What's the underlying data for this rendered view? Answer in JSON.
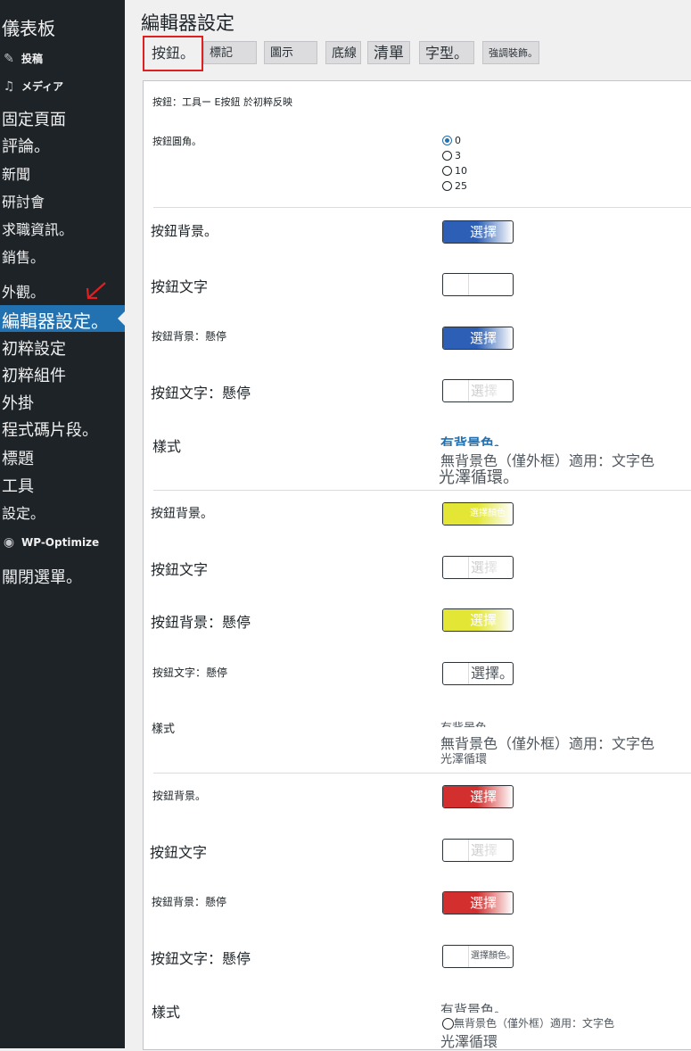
{
  "sidebar": {
    "dashboard": "儀表板",
    "posts": "投稿",
    "media": "メディア",
    "pages": "固定頁面",
    "comments": "評論。",
    "news": "新聞",
    "seminar": "研討會",
    "jobs": "求職資訊。",
    "sales": "銷售。",
    "appearance": "外觀。",
    "editor_settings": "編輯器設定。",
    "initial_settings": "初粹設定",
    "initial_blocks": "初粹組件",
    "plugins": "外掛",
    "code_snippets": "程式碼片段。",
    "titles": "標題",
    "tools": "工具",
    "settings": "設定。",
    "wp_optimize": "WP-Optimize",
    "close_menu": "關閉選單。"
  },
  "page": {
    "title": "編輯器設定"
  },
  "tabs": [
    "按鈕。",
    "標記",
    "圖示",
    "底線",
    "清單",
    "字型。",
    "強調裝飾。"
  ],
  "panel": {
    "description": "按鈕：工具ー E按鈕 於初粹反映",
    "radius_label": "按鈕圓角。",
    "radius_options": [
      "0",
      "3",
      "10",
      "25"
    ],
    "radius_selected": "0"
  },
  "groups": [
    {
      "bg": "按鈕背景。",
      "text": "按鈕文字",
      "bg_hover": "按鈕背景：懸停",
      "text_hover": "按鈕文字：懸停",
      "style": "樣式",
      "bg_color": "#2c5fb5",
      "text_color": "#ffffff",
      "bg_hover_color": "#2c5fb5",
      "text_hover_color": "#ffffff",
      "bg_pick": "選擇",
      "text_pick": "",
      "bg_hover_pick": "選擇",
      "text_hover_pick": "選擇",
      "style_opt1": "有背景色。",
      "style_opt2": "無背景色（僅外框）適用：文字色",
      "style_opt3": "光澤循環。"
    },
    {
      "bg": "按鈕背景。",
      "text": "按鈕文字",
      "bg_hover": "按鈕背景：懸停",
      "text_hover": "按鈕文字：懸停",
      "style": "樣式",
      "bg_color": "#e3e635",
      "text_color": "#ffffff",
      "bg_hover_color": "#e3e635",
      "text_hover_color": "#ffffff",
      "bg_pick": "選擇顏色",
      "text_pick": "選擇",
      "bg_hover_pick": "選擇",
      "text_hover_pick": "選擇。",
      "style_opt1": "有背景色。",
      "style_opt2": "無背景色（僅外框）適用：文字色",
      "style_opt3": "光澤循環"
    },
    {
      "bg": "按鈕背景。",
      "text": "按鈕文字",
      "bg_hover": "按鈕背景：懸停",
      "text_hover": "按鈕文字：懸停",
      "style": "樣式",
      "bg_color": "#d32f2f",
      "text_color": "#ffffff",
      "bg_hover_color": "#d32f2f",
      "text_hover_color": "#ffffff",
      "bg_pick": "選擇",
      "text_pick": "選擇",
      "bg_hover_pick": "選擇",
      "text_hover_pick": "選擇顏色。",
      "style_opt1": "有背景色。",
      "style_opt2": "無背景色（僅外框）適用：文字色",
      "style_opt3": "光澤循環"
    }
  ]
}
